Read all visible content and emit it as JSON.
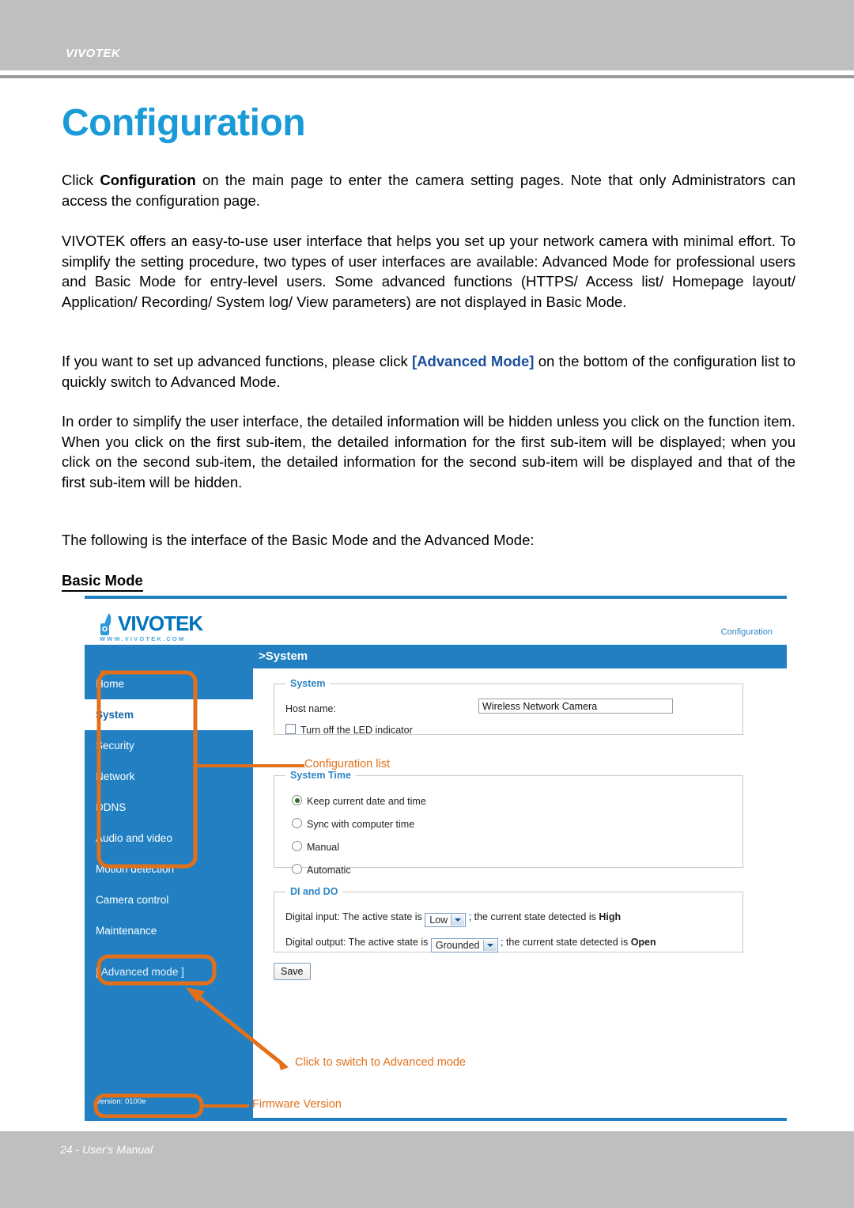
{
  "page": {
    "header_brand": "VIVOTEK",
    "title": "Configuration",
    "footer": "24 - User's Manual"
  },
  "body": {
    "p1_a": "Click ",
    "p1_b": "Configuration",
    "p1_c": " on the main page to enter the camera setting pages. Note that only Administrators can access the configuration page.",
    "p2": "VIVOTEK offers an easy-to-use user interface that helps you set up your network camera with minimal effort. To simplify the setting procedure, two types of user interfaces are available: Advanced Mode for professional users and Basic Mode for entry-level users. Some advanced functions (HTTPS/ Access list/ Homepage layout/ Application/ Recording/ System log/ View parameters) are not displayed in Basic Mode.",
    "p3_a": "If you want to set up advanced functions, please click ",
    "p3_b": "[Advanced Mode]",
    "p3_c": " on the bottom of the configuration list to quickly switch to Advanced Mode.",
    "p4": "In order to simplify the user interface, the detailed information will be hidden unless you click on the function item. When you click on the first sub-item, the detailed information for the first sub-item will be displayed; when you click on the second sub-item, the detailed information for the second sub-item will be displayed and that of the first sub-item will be hidden.",
    "p5": "The following is the interface of the Basic Mode and the Advanced Mode:",
    "subhead": "Basic Mode"
  },
  "screenshot": {
    "logo_word": "VIVOTEK",
    "logo_url": "WWW.VIVOTEK.COM",
    "top_right_label": "Configuration",
    "breadcrumb": ">System",
    "sidebar": {
      "items": [
        {
          "label": "Home",
          "active": false
        },
        {
          "label": "System",
          "active": true
        },
        {
          "label": "Security",
          "active": false
        },
        {
          "label": "Network",
          "active": false
        },
        {
          "label": "DDNS",
          "active": false
        },
        {
          "label": "Audio and video",
          "active": false
        },
        {
          "label": "Motion detection",
          "active": false
        },
        {
          "label": "Camera control",
          "active": false
        },
        {
          "label": "Maintenance",
          "active": false
        }
      ],
      "advanced_mode": "[ Advanced mode ]",
      "version": "Version: 0100e"
    },
    "system_box": {
      "legend": "System",
      "host_label": "Host name:",
      "host_value": "Wireless Network Camera",
      "led_label": "Turn off the LED indicator",
      "led_checked": false
    },
    "system_time_box": {
      "legend": "System Time",
      "options": [
        {
          "label": "Keep current date and time",
          "selected": true
        },
        {
          "label": "Sync with computer time",
          "selected": false
        },
        {
          "label": "Manual",
          "selected": false
        },
        {
          "label": "Automatic",
          "selected": false
        }
      ]
    },
    "di_do_box": {
      "legend": "DI and DO",
      "di_prefix": "Digital input: The active state is",
      "di_value": "Low",
      "di_mid": "; the current state detected is",
      "di_state": "High",
      "do_prefix": "Digital output: The active state is",
      "do_value": "Grounded",
      "do_mid": "; the current state detected is",
      "do_state": "Open"
    },
    "save_button": "Save",
    "annotations": {
      "config_list": "Configuration list",
      "switch_advanced": "Click to switch to Advanced mode",
      "firmware_version": "Firmware Version"
    }
  },
  "colors": {
    "accent_blue": "#1a9ad7",
    "ui_blue": "#2280c2",
    "annotation_orange": "#e2701a",
    "band_grey": "#bfbfbf"
  }
}
